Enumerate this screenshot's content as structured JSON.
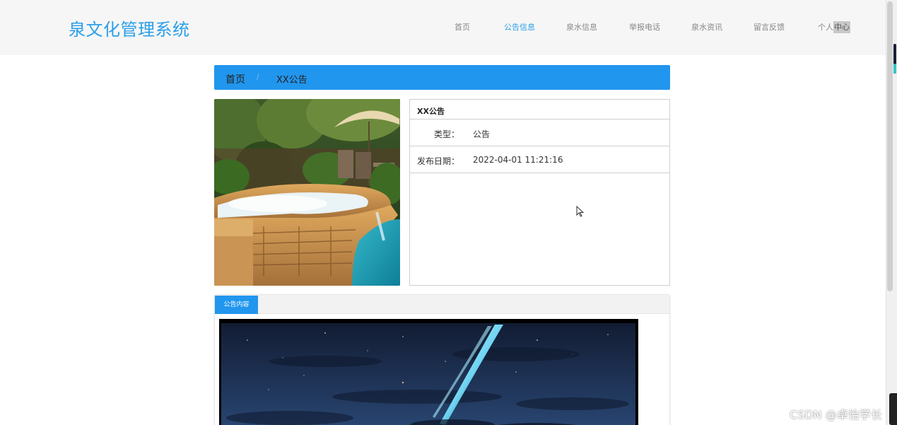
{
  "header": {
    "logo": "泉文化管理系统",
    "nav": [
      {
        "label": "首页",
        "active": false
      },
      {
        "label": "公告信息",
        "active": true
      },
      {
        "label": "泉水信息",
        "active": false
      },
      {
        "label": "举报电话",
        "active": false
      },
      {
        "label": "泉水资讯",
        "active": false
      },
      {
        "label": "留言反馈",
        "active": false
      }
    ],
    "personal_a": "个人",
    "personal_b": "中心"
  },
  "breadcrumb": {
    "home": "首页",
    "separator": "/",
    "current": "XX公告"
  },
  "info": {
    "title": "XX公告",
    "type_label": "类型：",
    "type_value": "公告",
    "date_label": "发布日期：",
    "date_value": "2022-04-01 11:21:16"
  },
  "content": {
    "tab_label": "公告内容"
  },
  "watermark": "CSDN @卓怡学长",
  "colors": {
    "accent": "#2196ee",
    "logo": "#2a9fe8"
  }
}
